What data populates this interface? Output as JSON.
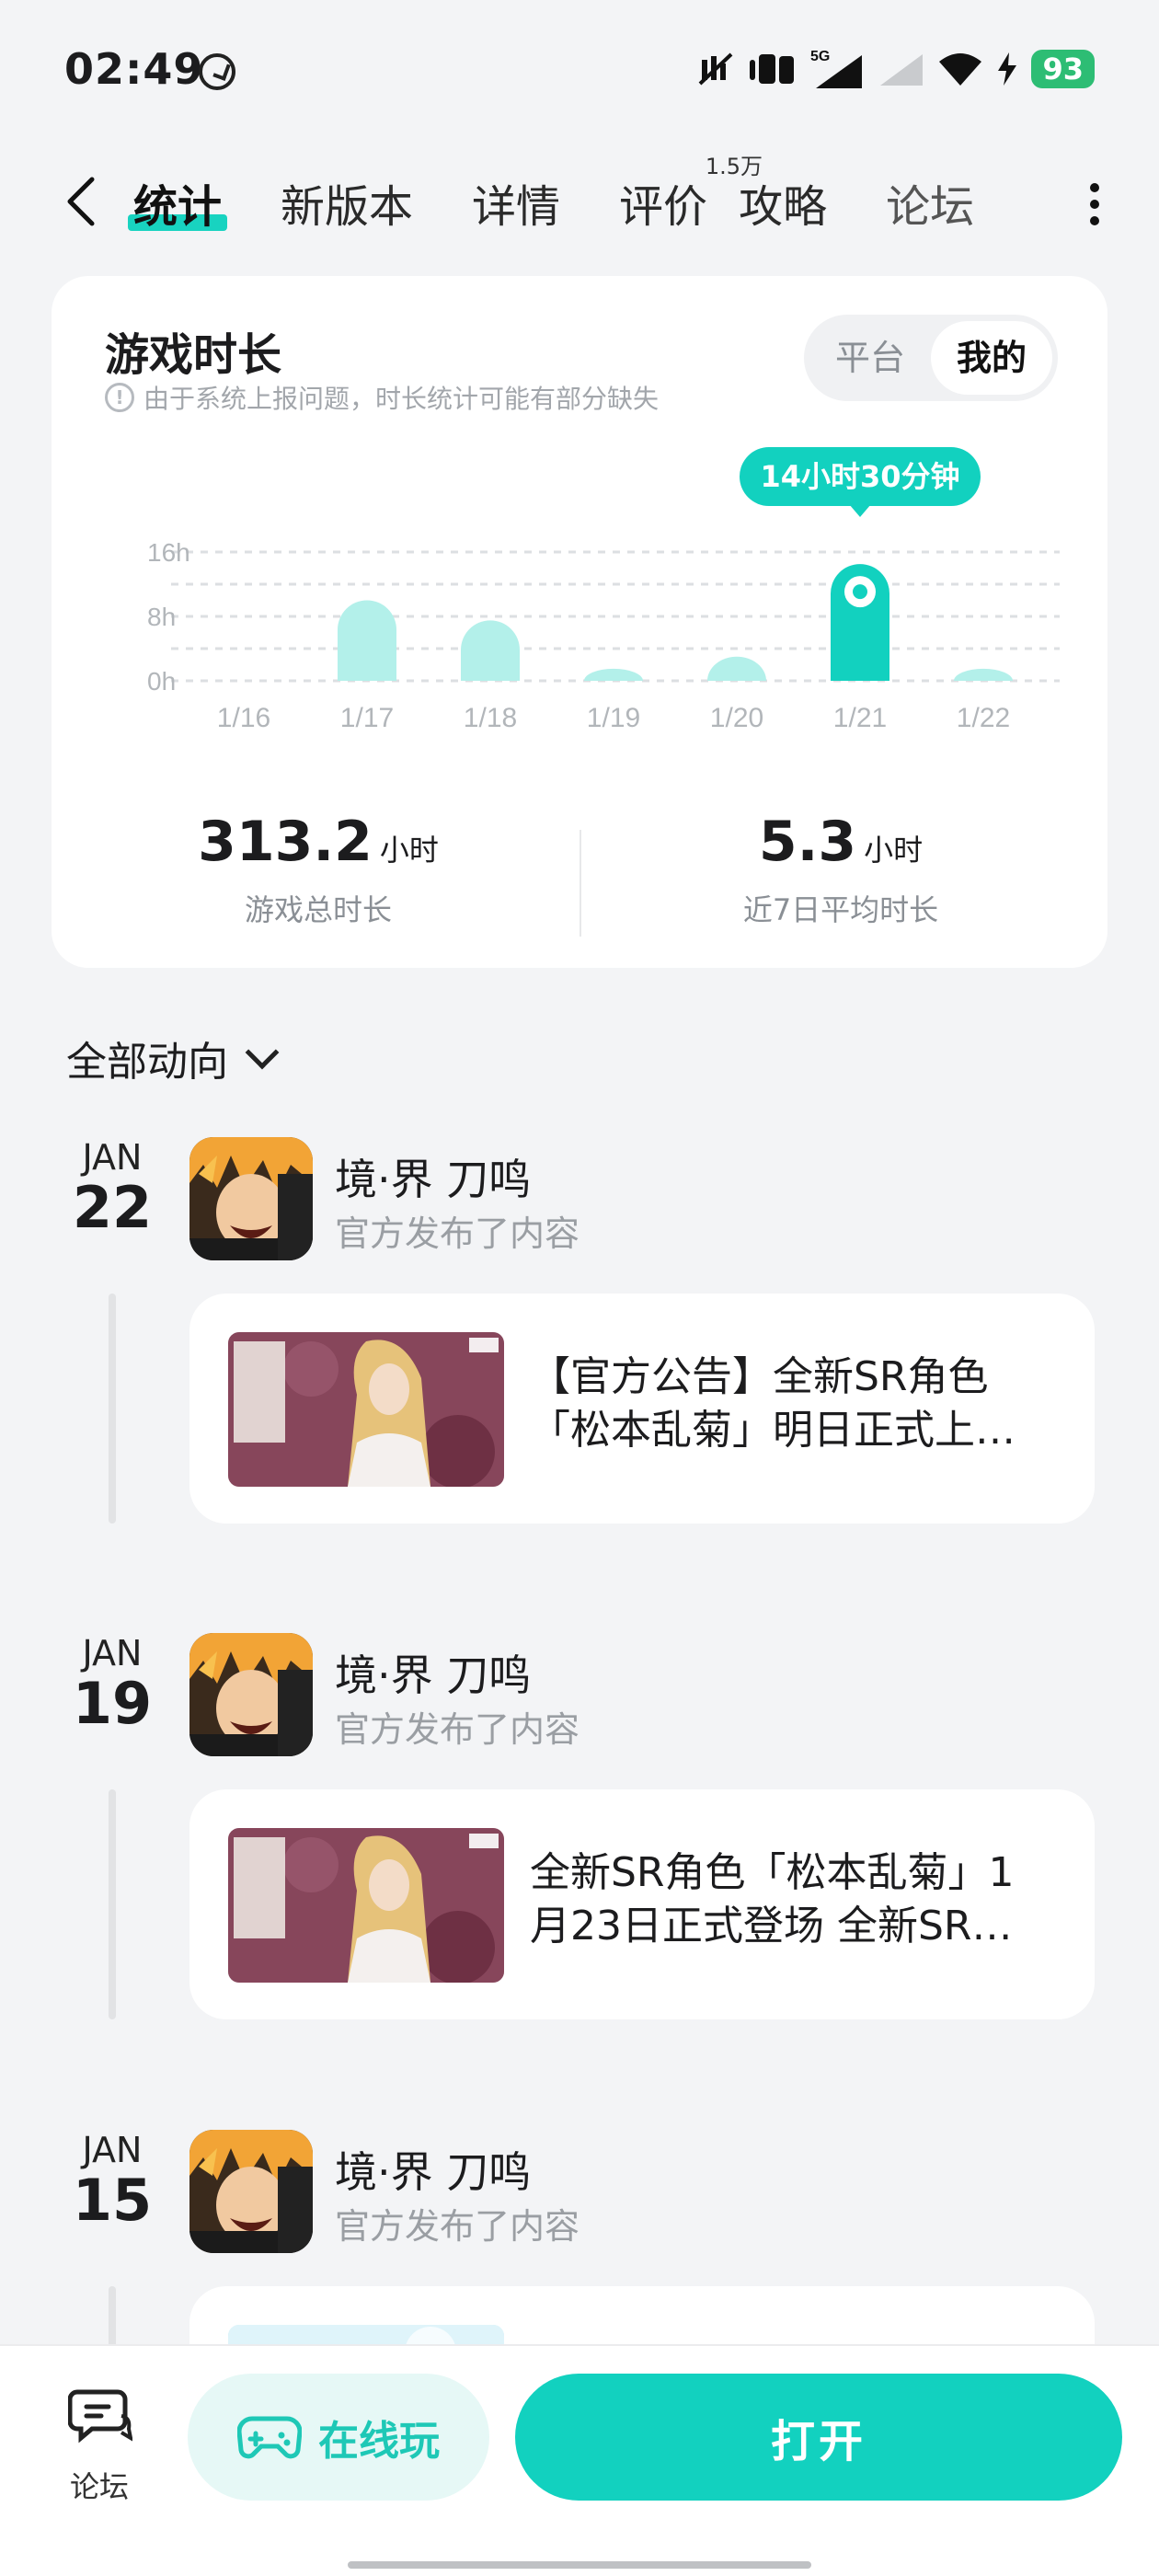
{
  "status": {
    "time": "02:49",
    "network": "5G",
    "battery": "93"
  },
  "nav": {
    "tabs": [
      {
        "label": "统计",
        "active": true
      },
      {
        "label": "新版本"
      },
      {
        "label": "详情"
      },
      {
        "label": "评价",
        "badge": "1.5万"
      },
      {
        "label": "攻略"
      },
      {
        "label": "论坛"
      }
    ]
  },
  "stats": {
    "title": "游戏时长",
    "note": "由于系统上报问题，时长统计可能有部分缺失",
    "toggle": {
      "platform": "平台",
      "mine": "我的"
    },
    "total": {
      "value": "313.2",
      "unit": "小时",
      "label": "游戏总时长"
    },
    "average": {
      "value": "5.3",
      "unit": "小时",
      "label": "近7日平均时长"
    }
  },
  "chart_data": {
    "type": "bar",
    "categories": [
      "1/16",
      "1/17",
      "1/18",
      "1/19",
      "1/20",
      "1/21",
      "1/22"
    ],
    "values": [
      0,
      10,
      7.5,
      1.5,
      3,
      14.5,
      1.5
    ],
    "yticks": [
      "0h",
      "8h",
      "16h"
    ],
    "ylim": [
      0,
      16
    ],
    "highlight_index": 5,
    "tooltip": "14小时30分钟",
    "bar_color": "#b3f0ea",
    "highlight_color": "#12d1bf",
    "grid": true
  },
  "feed": {
    "header": "全部动向",
    "entries": [
      {
        "month": "JAN",
        "day": "22",
        "game": "境·界 刀鸣",
        "action": "官方发布了内容",
        "text1": "【官方公告】全新SR角色",
        "text2": "「松本乱菊」明日正式上…"
      },
      {
        "month": "JAN",
        "day": "19",
        "game": "境·界 刀鸣",
        "action": "官方发布了内容",
        "text1": "全新SR角色「松本乱菊」1",
        "text2": "月23日正式登场 全新SR…"
      },
      {
        "month": "JAN",
        "day": "15",
        "game": "境·界 刀鸣",
        "action": "官方发布了内容",
        "text1": "",
        "text2": ""
      }
    ]
  },
  "bottom": {
    "forum": "论坛",
    "online": "在线玩",
    "open": "打开"
  }
}
